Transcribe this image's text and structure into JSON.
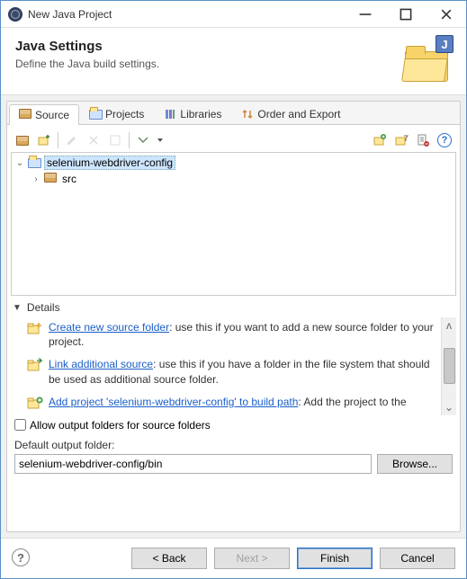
{
  "window": {
    "title": "New Java Project"
  },
  "banner": {
    "heading": "Java Settings",
    "sub": "Define the Java build settings."
  },
  "tabs": {
    "source": "Source",
    "projects": "Projects",
    "libraries": "Libraries",
    "order": "Order and Export"
  },
  "tree": {
    "project": "selenium-webdriver-config",
    "src": "src"
  },
  "details": {
    "header": "Details",
    "row1_link": "Create new source folder",
    "row1_rest": ": use this if you want to add a new source folder to your project.",
    "row2_link": "Link additional source",
    "row2_rest": ": use this if you have a folder in the file system that should be used as additional source folder.",
    "row3_link": "Add project 'selenium-webdriver-config' to build path",
    "row3_rest": ": Add the project to the"
  },
  "allow_output": "Allow output folders for source folders",
  "default_output_label": "Default output folder:",
  "default_output_value": "selenium-webdriver-config/bin",
  "browse": "Browse...",
  "buttons": {
    "back": "< Back",
    "next": "Next >",
    "finish": "Finish",
    "cancel": "Cancel"
  }
}
